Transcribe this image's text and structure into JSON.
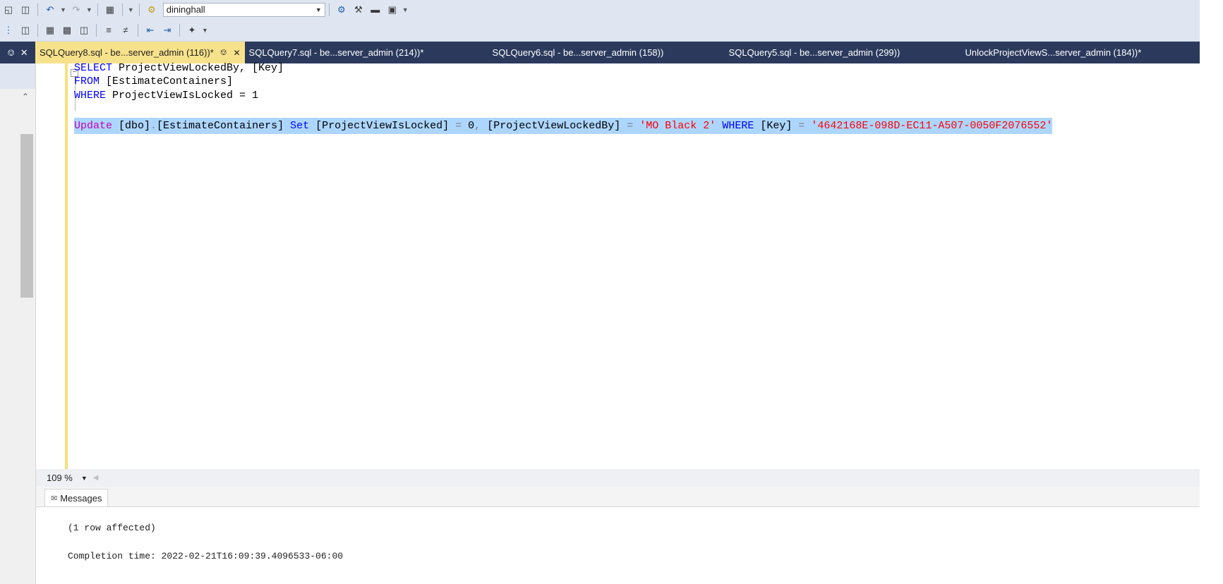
{
  "toolbar": {
    "database": "dininghall"
  },
  "tabs": [
    {
      "label": "SQLQuery8.sql - be...server_admin (116))*",
      "active": true
    },
    {
      "label": "SQLQuery7.sql - be...server_admin (214))*",
      "active": false
    },
    {
      "label": "SQLQuery6.sql - be...server_admin (158))",
      "active": false
    },
    {
      "label": "SQLQuery5.sql - be...server_admin (299))",
      "active": false
    },
    {
      "label": "UnlockProjectViewS...server_admin (184))*",
      "active": false
    }
  ],
  "editor": {
    "lines": {
      "l1": {
        "kw": "SELECT",
        "rest": " ProjectViewLockedBy, [Key]"
      },
      "l2": {
        "kw": "FROM",
        "rest": " [EstimateContainers]"
      },
      "l3": {
        "kw": "WHERE",
        "rest": " ProjectViewIsLocked = 1"
      },
      "l5": {
        "t1": "Update",
        "t2": " [dbo]",
        "t3": ".",
        "t4": "[EstimateContainers] ",
        "t5": "Set",
        "t6": " [ProjectViewIsLocked] ",
        "t7": "=",
        "t8": " 0",
        "t9": ",",
        "t10": " [ProjectViewLockedBy] ",
        "t11": "=",
        "t12": " ",
        "t13": "'MO Black 2'",
        "t14": " ",
        "t15": "WHERE",
        "t16": " [Key] ",
        "t17": "=",
        "t18": " ",
        "t19": "'4642168E-098D-EC11-A507-0050F2076552'"
      }
    }
  },
  "zoom": {
    "value": "109 %"
  },
  "results": {
    "tab_label": "Messages",
    "lines": [
      "(1 row affected)",
      "Completion time: 2022-02-21T16:09:39.4096533-06:00"
    ]
  },
  "icons": [
    "restore-icon",
    "undo-icon",
    "redo-icon",
    "database-icon",
    "wrench-icon",
    "pin-icon",
    "close-icon"
  ]
}
